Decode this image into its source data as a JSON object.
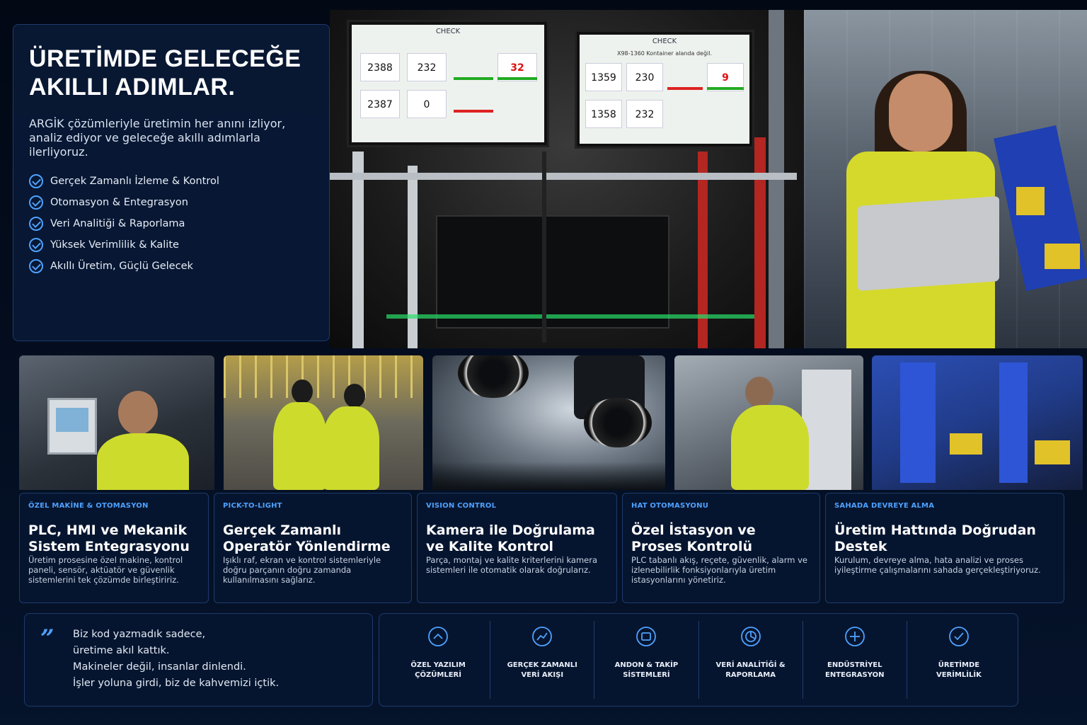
{
  "intro": {
    "title_line1": "ÜRETİMDE GELECEĞE",
    "title_line2": "AKILLI ADIMLAR.",
    "description": "ARGİK çözümleriyle üretimin her anını izliyor, analiz ediyor ve geleceğe akıllı adımlarla ilerliyoruz.",
    "features": [
      "Gerçek Zamanlı İzleme & Kontrol",
      "Otomasyon & Entegrasyon",
      "Veri Analitiği & Raporlama",
      "Yüksek Verimlilik & Kalite",
      "Akıllı Üretim, Güçlü Gelecek"
    ]
  },
  "monitors": [
    {
      "header": "CHECK",
      "sub": "",
      "values": [
        "2388",
        "232",
        "32",
        "2387",
        "0"
      ]
    },
    {
      "header": "CHECK",
      "sub": "X98-1360 Kontainer alanda değil.",
      "values": [
        "1359",
        "230",
        "9",
        "1358",
        "232"
      ]
    }
  ],
  "cards": [
    {
      "tag": "ÖZEL MAKİNE & OTOMASYON",
      "title": "PLC, HMI ve Mekanik Sistem Entegrasyonu",
      "desc": "Üretim prosesine özel makine, kontrol paneli, sensör, aktüatör ve güvenlik sistemlerini tek çözümde birleştiririz."
    },
    {
      "tag": "PICK-TO-LIGHT",
      "title": "Gerçek Zamanlı Operatör Yönlendirme",
      "desc": "Işıklı raf, ekran ve kontrol sistemleriyle doğru parçanın doğru zamanda kullanılmasını sağlarız."
    },
    {
      "tag": "VISION CONTROL",
      "title": "Kamera ile Doğrulama ve Kalite Kontrol",
      "desc": "Parça, montaj ve kalite kriterlerini kamera sistemleri ile otomatik olarak doğrularız."
    },
    {
      "tag": "HAT OTOMASYONU",
      "title": "Özel İstasyon ve Proses Kontrolü",
      "desc": "PLC tabanlı akış, reçete, güvenlik, alarm ve izlenebilirlik fonksiyonlarıyla üretim istasyonlarını yönetiriz."
    },
    {
      "tag": "SAHADA DEVREYE ALMA",
      "title": "Üretim Hattında Doğrudan Destek",
      "desc": "Kurulum, devreye alma, hata analizi ve proses iyileştirme çalışmalarını sahada gerçekleştiriyoruz."
    }
  ],
  "quote": {
    "mark": "”",
    "lines": [
      "Biz kod yazmadık sadece,",
      "üretime akıl kattık.",
      "Makineler değil, insanlar dinlendi.",
      "İşler yoluna girdi, biz de kahvemizi içtik."
    ]
  },
  "features_bar": [
    {
      "label": "ÖZEL YAZILIM ÇÖZÜMLERİ",
      "icon": "chevron-up-circle-icon"
    },
    {
      "label": "GERÇEK ZAMANLI VERİ AKIŞI",
      "icon": "trend-circle-icon"
    },
    {
      "label": "ANDON & TAKİP SİSTEMLERİ",
      "icon": "screen-circle-icon"
    },
    {
      "label": "VERİ ANALİTİĞİ & RAPORLAMA",
      "icon": "pie-circle-icon"
    },
    {
      "label": "ENDÜSTRİYEL ENTEGRASYON",
      "icon": "plus-circle-icon"
    },
    {
      "label": "ÜRETİMDE VERİMLİLİK",
      "icon": "check-circle-icon"
    }
  ],
  "colors": {
    "accent": "#4ea1ff",
    "panel": "#081834",
    "border": "#1e3b6b"
  }
}
